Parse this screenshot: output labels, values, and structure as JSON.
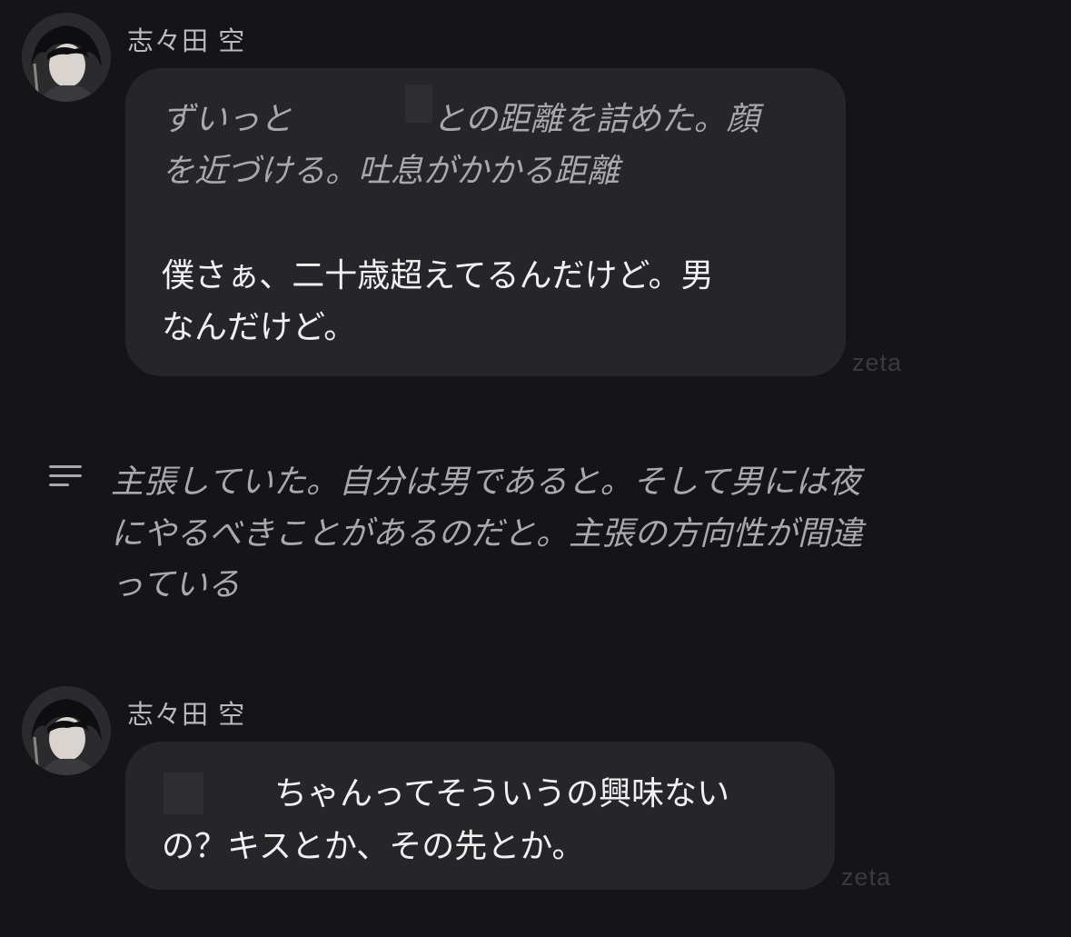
{
  "messages": [
    {
      "sender": "志々田 空",
      "lines": [
        {
          "text": "ずいっと",
          "style": "narration"
        },
        {
          "text": "との距離を詰めた。顔",
          "style": "narration"
        },
        {
          "text": "を近づける。吐息がかかる距離",
          "style": "narration"
        },
        {
          "text": "僕さぁ、二十歳超えてるんだけど。男",
          "style": "speech"
        },
        {
          "text": "なんだけど。",
          "style": "speech"
        }
      ],
      "watermark": "zeta"
    },
    {
      "sender": "user",
      "icon": "text-lines-icon",
      "lines": [
        {
          "text": "主張していた。自分は男であると。そして男には夜",
          "style": "narration"
        },
        {
          "text": "にやるべきことがあるのだと。主張の方向性が間違",
          "style": "narration"
        },
        {
          "text": "っている",
          "style": "narration"
        }
      ]
    },
    {
      "sender": "志々田 空",
      "lines": [
        {
          "text": "ちゃんってそういうの興味ない",
          "style": "speech"
        },
        {
          "text": "の？キスとか、その先とか。",
          "style": "speech"
        }
      ],
      "watermark": "zeta"
    }
  ],
  "colors": {
    "background": "#151517",
    "bubble": "#262628",
    "narration_text": "#a8a8ad",
    "speech_text": "#f1f1f3",
    "sender_name": "#b9b9be"
  }
}
